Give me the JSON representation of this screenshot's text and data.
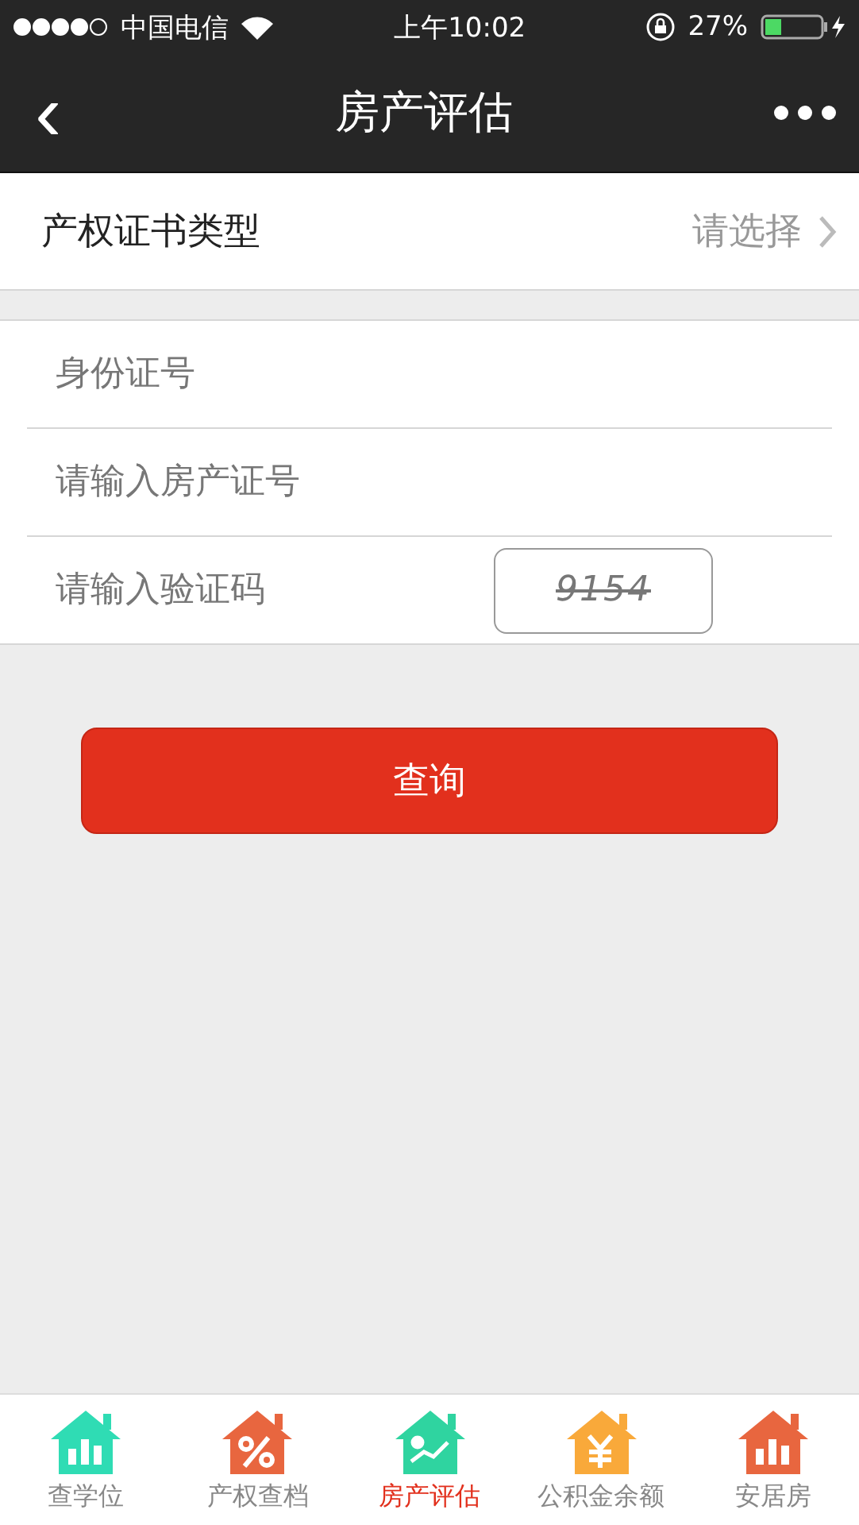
{
  "status_bar": {
    "carrier": "中国电信",
    "time": "上午10:02",
    "battery": "27%"
  },
  "nav": {
    "title": "房产评估",
    "back": "‹"
  },
  "cert_type": {
    "label": "产权证书类型",
    "value": "请选择"
  },
  "fields": [
    {
      "kind": "text",
      "placeholder": "身份证号"
    },
    {
      "kind": "text",
      "placeholder": "请输入房产证号"
    },
    {
      "kind": "captcha",
      "placeholder": "请输入验证码",
      "captcha": "9154"
    }
  ],
  "submit": "查询",
  "tabs": [
    {
      "label": "查学位",
      "kind": "chart",
      "color": "#2fdcb4",
      "selected": false
    },
    {
      "label": "产权查档",
      "kind": "percent",
      "color": "#e8663f",
      "selected": false
    },
    {
      "label": "房产评估",
      "kind": "trend",
      "color": "#2fd4a0",
      "selected": true
    },
    {
      "label": "公积金余额",
      "kind": "yen",
      "color": "#f9a93a",
      "selected": false
    },
    {
      "label": "安居房",
      "kind": "chart",
      "color": "#e8663f",
      "selected": false
    }
  ]
}
